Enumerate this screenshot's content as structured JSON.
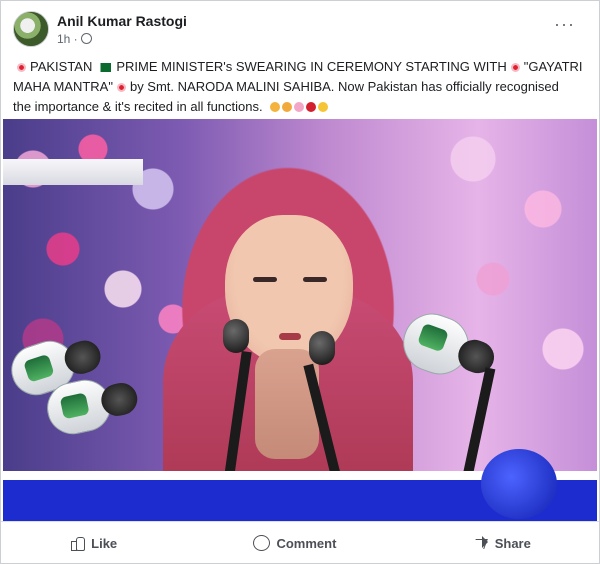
{
  "post": {
    "author": "Anil Kumar Rastogi",
    "time": "1h ·",
    "text_line1_a": "PAKISTAN",
    "text_line1_b": "PRIME MINISTER's SWEARING IN CEREMONY STARTING WITH",
    "text_line1_c": "\"GAYATRI",
    "text_line2_a": "MAHA MANTRA\"",
    "text_line2_b": "by Smt. NARODA MALINI SAHIBA. Now Pakistan has officially recognised",
    "text_line3": "the importance & it's recited in all functions.",
    "more_label": "···"
  },
  "actions": {
    "like": "Like",
    "comment": "Comment",
    "share": "Share"
  },
  "colors": {
    "text": "#1c1e21",
    "muted": "#606770",
    "banner_blue": "#1c2ccf"
  },
  "icons": [
    "globe-icon",
    "more-icon",
    "like-icon",
    "comment-icon",
    "share-icon"
  ]
}
